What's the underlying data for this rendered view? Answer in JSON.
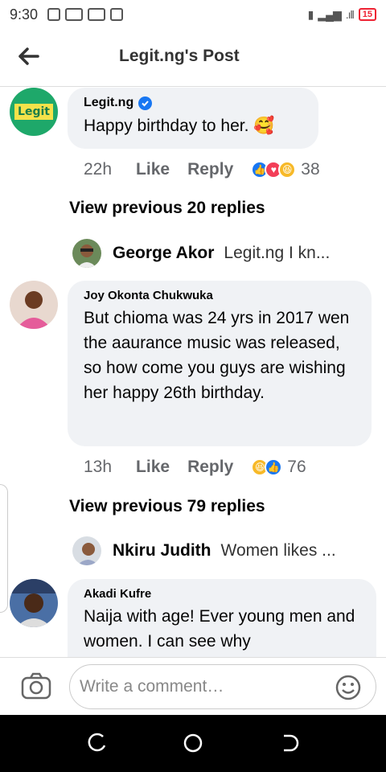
{
  "status_bar": {
    "time": "9:30",
    "battery": "15"
  },
  "header": {
    "title": "Legit.ng's Post"
  },
  "comments": [
    {
      "avatar_text": "Legit",
      "author": "Legit.ng",
      "text": "Happy birthday to her. 🥰",
      "time": "22h",
      "like": "Like",
      "reply": "Reply",
      "reaction_count": "38"
    },
    {
      "author": "Joy Okonta Chukwuka",
      "text": "But chioma was 24 yrs in 2017 wen the aaurance music was released, so how come you guys are wishing her happy 26th birthday.",
      "time": "13h",
      "like": "Like",
      "reply": "Reply",
      "reaction_count": "76"
    },
    {
      "author": "Akadi Kufre",
      "text": "Naija with age!  Ever young men and women. I can see why"
    }
  ],
  "view_previous": [
    "View previous 20 replies",
    "View previous 79 replies"
  ],
  "reply_previews": [
    {
      "name": "George Akor",
      "text": "Legit.ng I kn..."
    },
    {
      "name": "Nkiru Judith",
      "text": "Women likes ..."
    }
  ],
  "composer": {
    "placeholder": "Write a comment…"
  },
  "colors": {
    "accent": "#1877f2",
    "bubble": "#f0f2f5",
    "legit_green": "#1ea86a",
    "legit_yellow": "#f5e24a"
  }
}
